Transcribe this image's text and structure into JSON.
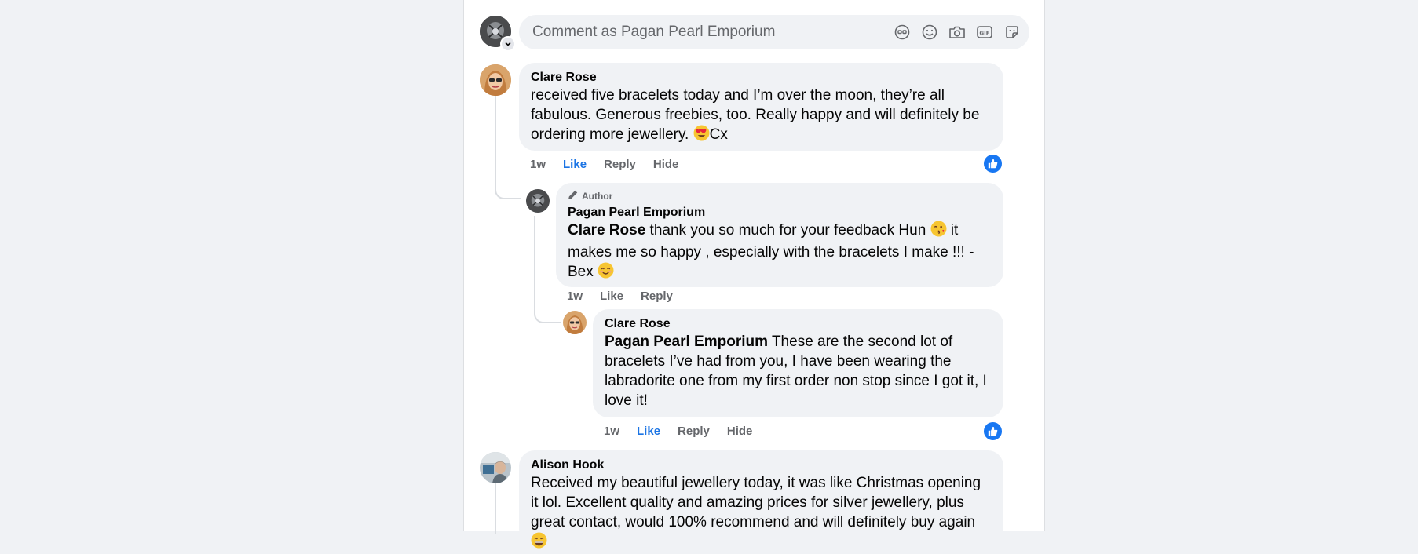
{
  "composer": {
    "placeholder": "Comment as Pagan Pearl Emporium",
    "icons": [
      "avatar-frame-icon",
      "emoji-icon",
      "camera-icon",
      "gif-icon",
      "sticker-icon"
    ]
  },
  "comments": [
    {
      "name": "Clare Rose",
      "text": "received five bracelets today and I’m over the moon, they’re all fabulous. Generous freebies, too. Really happy and will definitely be ordering more jewellery.",
      "text_after_emoji": "Cx",
      "emoji": "heart-eyes",
      "time": "1w",
      "like": "Like",
      "reply": "Reply",
      "hide": "Hide",
      "liked": true
    },
    {
      "badge": "Author",
      "name": "Pagan Pearl Emporium",
      "mention": "Clare Rose",
      "text_a": " thank you so much for your feedback Hun ",
      "text_b": " it makes me so happy , especially with the bracelets I make !!! - Bex ",
      "time": "1w",
      "like": "Like",
      "reply": "Reply"
    },
    {
      "name": "Clare Rose",
      "mention": "Pagan Pearl Emporium",
      "text": " These are the second lot of bracelets I’ve had from you, I have been wearing the labradorite one from my first order non stop since I got it, I love it!",
      "time": "1w",
      "like": "Like",
      "reply": "Reply",
      "hide": "Hide",
      "liked": true
    },
    {
      "name": "Alison Hook",
      "text": "Received my beautiful jewellery today, it was like Christmas opening it lol. Excellent quality and amazing prices for silver jewellery, plus great contact, would 100% recommend and will definitely buy again "
    }
  ],
  "colors": {
    "like_blue": "#1877f2",
    "liked_text": "#1b74e4",
    "bubble_bg": "#f0f2f5",
    "secondary_text": "#65676b"
  }
}
